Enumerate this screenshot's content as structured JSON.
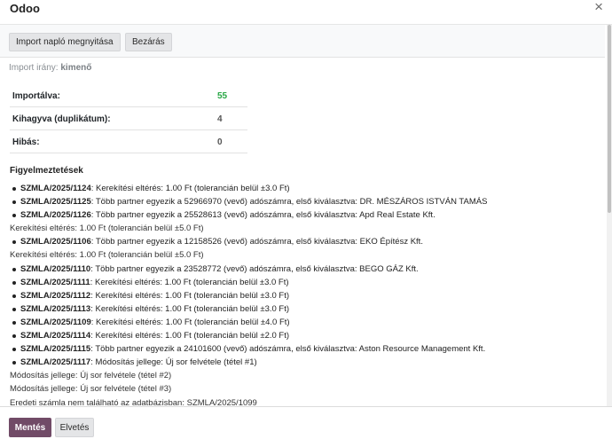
{
  "dialog": {
    "title": "Odoo",
    "close_icon": "×"
  },
  "toolbar": {
    "open_log_label": "Import napló megnyitása",
    "close_label": "Bezárás"
  },
  "direction": {
    "label": "Import irány:",
    "value": "kimenő"
  },
  "stats": [
    {
      "label": "Importálva:",
      "value": "55"
    },
    {
      "label": "Kihagyva (duplikátum):",
      "value": "4"
    },
    {
      "label": "Hibás:",
      "value": "0"
    }
  ],
  "warnings": {
    "title": "Figyelmeztetések",
    "items": [
      {
        "ref": "SZMLA/2025/1124",
        "text": ": Kerekítési eltérés: 1.00 Ft (tolerancián belül ±3.0 Ft)",
        "subs": []
      },
      {
        "ref": "SZMLA/2025/1125",
        "text": ": Több partner egyezik a 52966970 (vevő) adószámra, első kiválasztva: DR. MÉSZÁROS ISTVÁN TAMÁS",
        "subs": []
      },
      {
        "ref": "SZMLA/2025/1126",
        "text": ": Több partner egyezik a 25528613 (vevő) adószámra, első kiválasztva: Apd Real Estate Kft.",
        "subs": [
          "Kerekítési eltérés: 1.00 Ft (tolerancián belül ±5.0 Ft)"
        ]
      },
      {
        "ref": "SZMLA/2025/1106",
        "text": ": Több partner egyezik a 12158526 (vevő) adószámra, első kiválasztva: EKO Építész Kft.",
        "subs": [
          "Kerekítési eltérés: 1.00 Ft (tolerancián belül ±5.0 Ft)"
        ]
      },
      {
        "ref": "SZMLA/2025/1110",
        "text": ": Több partner egyezik a 23528772 (vevő) adószámra, első kiválasztva: BEGO GÁZ Kft.",
        "subs": []
      },
      {
        "ref": "SZMLA/2025/1111",
        "text": ": Kerekítési eltérés: 1.00 Ft (tolerancián belül ±3.0 Ft)",
        "subs": []
      },
      {
        "ref": "SZMLA/2025/1112",
        "text": ": Kerekítési eltérés: 1.00 Ft (tolerancián belül ±3.0 Ft)",
        "subs": []
      },
      {
        "ref": "SZMLA/2025/1113",
        "text": ": Kerekítési eltérés: 1.00 Ft (tolerancián belül ±3.0 Ft)",
        "subs": []
      },
      {
        "ref": "SZMLA/2025/1109",
        "text": ": Kerekítési eltérés: 1.00 Ft (tolerancián belül ±4.0 Ft)",
        "subs": []
      },
      {
        "ref": "SZMLA/2025/1114",
        "text": ": Kerekítési eltérés: 1.00 Ft (tolerancián belül ±2.0 Ft)",
        "subs": []
      },
      {
        "ref": "SZMLA/2025/1115",
        "text": ": Több partner egyezik a 24101600 (vevő) adószámra, első kiválasztva: Aston Resource Management Kft.",
        "subs": []
      },
      {
        "ref": "SZMLA/2025/1117",
        "text": ": Módosítás jellege: Új sor felvétele (tétel #1)",
        "subs": [
          "Módosítás jellege: Új sor felvétele (tétel #2)",
          "Módosítás jellege: Új sor felvétele (tétel #3)",
          "Eredeti számla nem található az adatbázisban: SZMLA/2025/1099"
        ]
      }
    ]
  },
  "footer": {
    "save_label": "Mentés",
    "discard_label": "Elvetés"
  },
  "colors": {
    "primary": "#714b67",
    "success": "#28a745"
  }
}
